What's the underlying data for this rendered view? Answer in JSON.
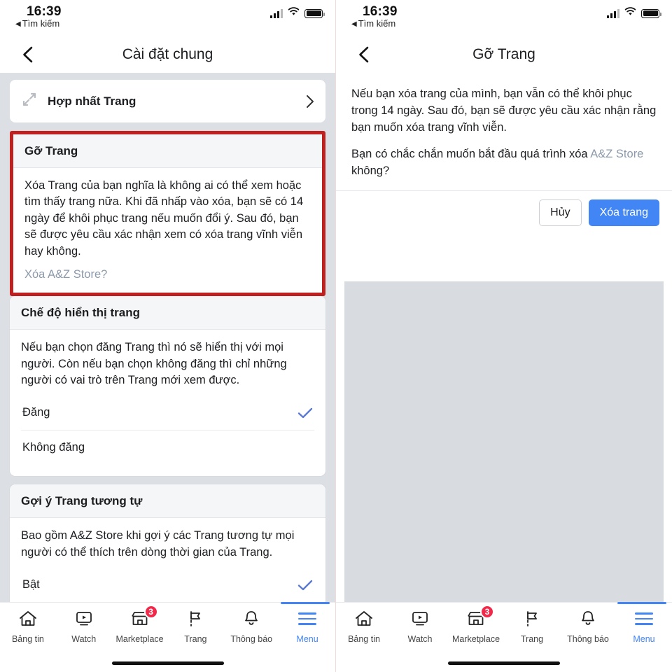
{
  "status_bar": {
    "time": "16:39",
    "back_label": "Tìm kiếm",
    "signal_icon": "cellular-signal-icon",
    "wifi_icon": "wifi-icon",
    "battery_icon": "battery-icon"
  },
  "left_panel": {
    "nav": {
      "title": "Cài đặt chung",
      "back_icon": "chevron-left-icon"
    },
    "merge_row": {
      "icon": "merge-arrows-icon",
      "label": "Hợp nhất Trang",
      "chevron": "chevron-right-icon"
    },
    "remove_page_card": {
      "header": "Gỡ Trang",
      "body": "Xóa Trang của bạn nghĩa là không ai có thể xem hoặc tìm thấy trang nữa. Khi đã nhấp vào xóa, bạn sẽ có 14 ngày để khôi phục trang nếu muốn đổi ý. Sau đó, bạn sẽ được yêu cầu xác nhận xem có xóa trang vĩnh viễn hay không.",
      "link": "Xóa A&Z Store?",
      "highlight_color": "#bf2020"
    },
    "visibility_card": {
      "header": "Chế độ hiển thị trang",
      "body": "Nếu bạn chọn đăng Trang thì nó sẽ hiển thị với mọi người. Còn nếu bạn chọn không đăng thì chỉ những người có vai trò trên Trang mới xem được.",
      "options": [
        {
          "label": "Đăng",
          "selected": true
        },
        {
          "label": "Không đăng",
          "selected": false
        }
      ]
    },
    "similar_pages_card": {
      "header": "Gợi ý Trang tương tự",
      "body": "Bao gồm A&Z Store khi gợi ý các Trang tương tự mọi người có thể thích trên dòng thời gian của Trang.",
      "options": [
        {
          "label": "Bật",
          "selected": true
        }
      ]
    }
  },
  "right_panel": {
    "nav": {
      "title": "Gỡ Trang",
      "back_icon": "chevron-left-icon"
    },
    "dialog": {
      "paragraph1": "Nếu bạn xóa trang của mình, bạn vẫn có thể khôi phục trong 14 ngày. Sau đó, bạn sẽ được yêu cầu xác nhận rằng bạn muốn xóa trang vĩnh viễn.",
      "paragraph2_before": "Bạn có chắc chắn muốn bắt đầu quá trình xóa ",
      "paragraph2_page": "A&Z Store",
      "paragraph2_after": " không?",
      "cancel_label": "Hủy",
      "confirm_label": "Xóa trang",
      "confirm_color": "#4285f4"
    }
  },
  "tabbar": {
    "items": [
      {
        "label": "Bảng tin",
        "icon": "home-icon",
        "active": false,
        "badge": null
      },
      {
        "label": "Watch",
        "icon": "video-play-icon",
        "active": false,
        "badge": null
      },
      {
        "label": "Marketplace",
        "icon": "storefront-icon",
        "active": false,
        "badge": "3"
      },
      {
        "label": "Trang",
        "icon": "flag-icon",
        "active": false,
        "badge": null
      },
      {
        "label": "Thông báo",
        "icon": "bell-icon",
        "active": false,
        "badge": null
      },
      {
        "label": "Menu",
        "icon": "hamburger-menu-icon",
        "active": true,
        "badge": null
      }
    ],
    "accent_color": "#4285f4",
    "badge_color": "#f02849"
  }
}
